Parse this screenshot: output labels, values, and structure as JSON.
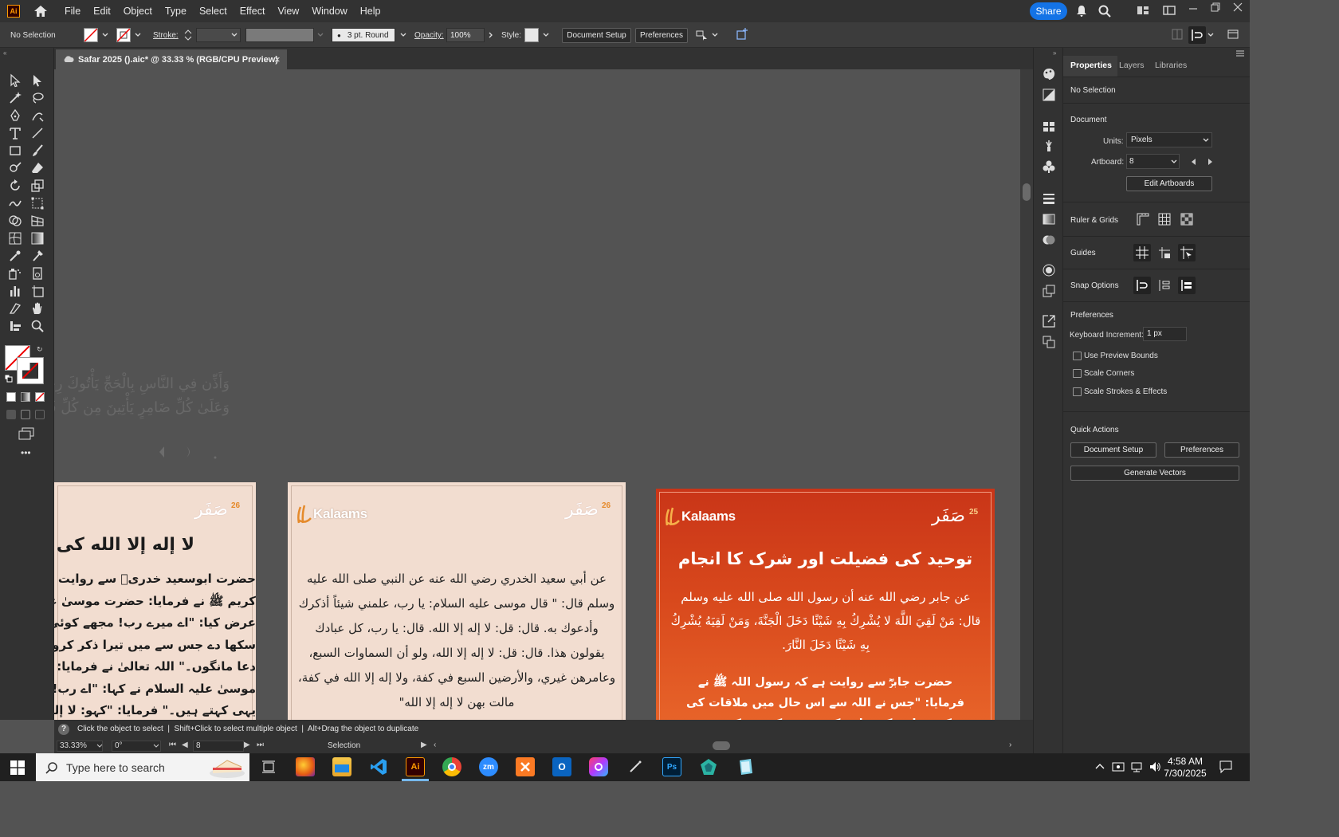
{
  "app": {
    "logo": "Ai",
    "menu": [
      "File",
      "Edit",
      "Object",
      "Type",
      "Select",
      "Effect",
      "View",
      "Window",
      "Help"
    ],
    "share_label": "Share"
  },
  "control_bar": {
    "selection": "No Selection",
    "stroke_label": "Stroke:",
    "brush": "3 pt. Round",
    "opacity_label": "Opacity:",
    "opacity_value": "100%",
    "style_label": "Style:",
    "document_setup": "Document Setup",
    "preferences": "Preferences"
  },
  "document_tab": {
    "title": "Safar 2025 ().aic* @ 33.33 % (RGB/CPU Preview)",
    "close": "×"
  },
  "canvas": {
    "calligraphy_line1": "وَأَذِّن فِي النَّاسِ بِالْحَجِّ يَأْتُوكَ رِجَالًا",
    "calligraphy_line2": "وَعَلَىٰ كُلِّ ضَامِرٍ يَأْتِينَ مِن كُلِّ فَجٍّ عَمِيقٍ",
    "artboard1": {
      "safar": "صَفَر",
      "safar_num": "26",
      "heading": "لا إله إلا الله کی فضیلت",
      "lines": [
        "حضرت ابوسعید خدریؓ سے روایت ہے کہ رسول اللہ",
        "کریم ﷺ نے فرمایا: حضرت موسیٰ علیہ السلام نے",
        "عرض کیا: \"اے میرے رب! مجھے کوئی ایسی چیز",
        "سکھا دے جس سے میں تیرا ذکر کروں اور تجھ سے",
        "دعا مانگوں۔\" اللہ تعالیٰ نے فرمایا: \"کہو",
        "موسیٰ علیہ السلام نے کہا: \"اے رب! یہ تو سب",
        "یہی کہتے ہیں۔\" فرمایا: \"کہو: لا إله إلا الله\""
      ]
    },
    "artboard2": {
      "brand": "Kalaams",
      "safar": "صَفَر",
      "safar_num": "26",
      "text": "عن أبي سعيد الخدري رضي الله عنه عن النبي صلى الله عليه وسلم قال: \" قال موسى عليه السلام: يا رب، علمني شيئاً أذكرك وأدعوك به. قال: قل: لا إله إلا الله. قال: يا رب، كل عبادك يقولون هذا. قال: قل: لا إله إلا الله، ولو أن السماوات السبع، وعامرهن غيري، والأرضين السبع في كفة، ولا إله إلا الله في كفة، مالت بهن لا إله إلا الله\""
    },
    "artboard3": {
      "brand": "Kalaams",
      "safar": "صَفَر",
      "safar_num": "25",
      "heading": "توحید کی فضیلت اور شرک کا انجام",
      "arabic": "عن جابر رضي الله عنه أن رسول الله صلى الله عليه وسلم قال: مَنْ لَقِيَ اللَّهَ لا يُشْرِكُ بِهِ شَيْئًا دَخَلَ الْجَنَّةَ، وَمَنْ لَقِيَهُ يُشْرِكُ بِهِ شَيْئًا دَخَلَ النَّارَ.",
      "urdu": "حضرت جابرؓ سے روایت ہے کہ رسول اللہ ﷺ نے فرمایا: \"جس نے اللہ سے اس حال میں ملاقات کی کہ وہ اس کے ساتھ کسی چیز کو شریک نہیں ٹھہراتا تھا"
    }
  },
  "status": {
    "help_text": "Click the object to select  |  Shift+Click to select multiple object  |  Alt+Drag the object to duplicate",
    "zoom": "33.33%",
    "rotation": "0°",
    "artboard_num": "8",
    "tool": "Selection"
  },
  "properties": {
    "tabs": [
      "Properties",
      "Layers",
      "Libraries"
    ],
    "no_selection": "No Selection",
    "document": "Document",
    "units_label": "Units:",
    "units_value": "Pixels",
    "artboard_label": "Artboard:",
    "artboard_value": "8",
    "edit_artboards": "Edit Artboards",
    "ruler_grids": "Ruler & Grids",
    "guides": "Guides",
    "snap_options": "Snap Options",
    "preferences": "Preferences",
    "keyboard_increment_label": "Keyboard Increment:",
    "keyboard_increment_value": "1 px",
    "checkboxes": [
      "Use Preview Bounds",
      "Scale Corners",
      "Scale Strokes & Effects"
    ],
    "quick_actions": "Quick Actions",
    "qa_document_setup": "Document Setup",
    "qa_preferences": "Preferences",
    "qa_generate_vectors": "Generate Vectors"
  },
  "taskbar": {
    "search_placeholder": "Type here to search",
    "time": "4:58 AM",
    "date": "7/30/2025",
    "apps": [
      "firefox",
      "file-explorer",
      "vscode",
      "Ai",
      "chrome",
      "zm",
      "xampp",
      "outlook",
      "creative-cloud",
      "pen",
      "Ps",
      "app-green",
      "app-blue"
    ]
  },
  "colors": {
    "accent": "#1473e6",
    "ai_orange": "#ff9a00",
    "artboard_bg": "#f2ddd0",
    "artboard_orange": "#d8481c"
  }
}
